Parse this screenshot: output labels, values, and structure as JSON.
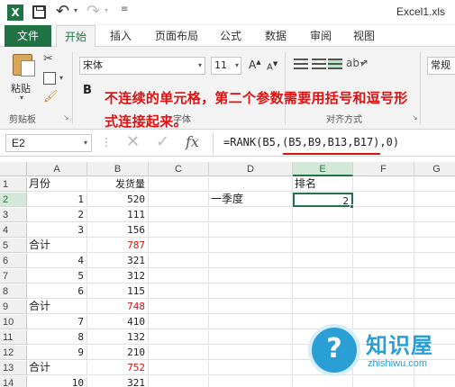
{
  "window": {
    "title": "Excel1.xls"
  },
  "quick_access": {
    "app_icon": "X",
    "undo_icon": "↶",
    "redo_icon": "↷"
  },
  "tabs": [
    {
      "label": "文件"
    },
    {
      "label": "开始"
    },
    {
      "label": "插入"
    },
    {
      "label": "页面布局"
    },
    {
      "label": "公式"
    },
    {
      "label": "数据"
    },
    {
      "label": "审阅"
    },
    {
      "label": "视图"
    }
  ],
  "active_tab": "开始",
  "ribbon": {
    "paste_label": "粘贴",
    "clipboard_group": "剪贴板",
    "font_name": "宋体",
    "font_size": "11",
    "bold": "B",
    "grow_font": "A",
    "shrink_font": "A",
    "font_group": "字体",
    "align_group": "对齐方式",
    "number_format": "常规"
  },
  "annotation": {
    "line1": "不连续的单元格，第二个参数需要用括号和逗号形",
    "line2": "式连接起来。"
  },
  "formula_bar": {
    "name_box": "E2",
    "fx": "fx",
    "formula": "=RANK(B5,(B5,B9,B13,B17),0)"
  },
  "grid": {
    "columns": [
      "A",
      "B",
      "C",
      "D",
      "E",
      "F",
      "G"
    ],
    "selected_column": "E",
    "selected_row": "2",
    "rows": [
      {
        "n": "1",
        "a": "月份",
        "b": "发货量",
        "d": "",
        "e": "排名"
      },
      {
        "n": "2",
        "a": "1",
        "b": "520",
        "d": "一季度",
        "e": "2"
      },
      {
        "n": "3",
        "a": "2",
        "b": "111",
        "d": "",
        "e": ""
      },
      {
        "n": "4",
        "a": "3",
        "b": "156",
        "d": "",
        "e": ""
      },
      {
        "n": "5",
        "a": "合计",
        "b": "787",
        "d": "",
        "e": ""
      },
      {
        "n": "6",
        "a": "4",
        "b": "321",
        "d": "",
        "e": ""
      },
      {
        "n": "7",
        "a": "5",
        "b": "312",
        "d": "",
        "e": ""
      },
      {
        "n": "8",
        "a": "6",
        "b": "115",
        "d": "",
        "e": ""
      },
      {
        "n": "9",
        "a": "合计",
        "b": "748",
        "d": "",
        "e": ""
      },
      {
        "n": "10",
        "a": "7",
        "b": "410",
        "d": "",
        "e": ""
      },
      {
        "n": "11",
        "a": "8",
        "b": "132",
        "d": "",
        "e": ""
      },
      {
        "n": "12",
        "a": "9",
        "b": "210",
        "d": "",
        "e": ""
      },
      {
        "n": "13",
        "a": "合计",
        "b": "752",
        "d": "",
        "e": ""
      },
      {
        "n": "14",
        "a": "10",
        "b": "321",
        "d": "",
        "e": ""
      }
    ]
  },
  "watermark": {
    "title": "知识屋",
    "url": "zhishiwu.com",
    "icon": "?"
  }
}
